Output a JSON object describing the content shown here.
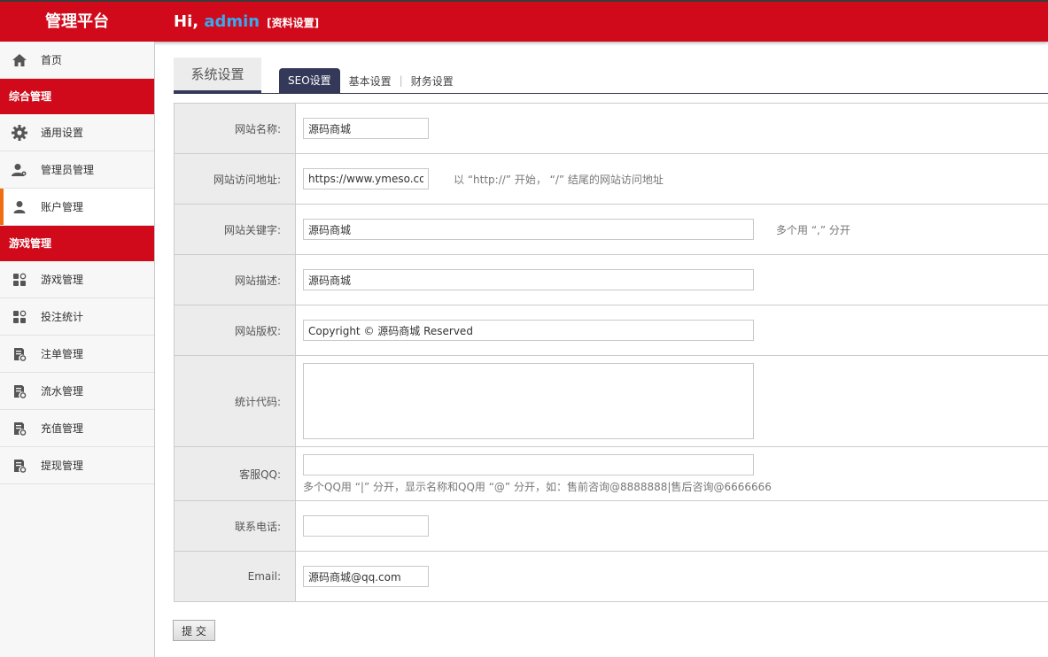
{
  "header": {
    "logo": "管理平台",
    "greeting_prefix": "Hi, ",
    "username": "admin",
    "profile_link": "[资料设置]"
  },
  "sidebar": {
    "home": "首页",
    "group1": "综合管理",
    "items1": [
      "通用设置",
      "管理员管理",
      "账户管理"
    ],
    "group2": "游戏管理",
    "items2": [
      "游戏管理",
      "投注统计",
      "注单管理",
      "流水管理",
      "充值管理",
      "提现管理"
    ]
  },
  "tabs": {
    "main": "系统设置",
    "sub": [
      "SEO设置",
      "基本设置",
      "财务设置"
    ],
    "separator": "|"
  },
  "form": {
    "site_name": {
      "label": "网站名称:",
      "value": "源码商城"
    },
    "site_url": {
      "label": "网站访问地址:",
      "value": "https://www.ymeso.com",
      "hint": "以 “http://” 开始， “/” 结尾的网站访问地址"
    },
    "keywords": {
      "label": "网站关键字:",
      "value": "源码商城",
      "hint": "多个用 “,” 分开"
    },
    "description": {
      "label": "网站描述:",
      "value": "源码商城"
    },
    "copyright": {
      "label": "网站版权:",
      "value": "Copyright © 源码商城 Reserved"
    },
    "stat_code": {
      "label": "统计代码:",
      "value": ""
    },
    "qq": {
      "label": "客服QQ:",
      "value": "",
      "hint": "多个QQ用 “|” 分开，显示名称和QQ用 “@” 分开，如：售前咨询@8888888|售后咨询@6666666"
    },
    "phone": {
      "label": "联系电话:",
      "value": ""
    },
    "email": {
      "label": "Email:",
      "value": "源码商城@qq.com"
    }
  },
  "submit_label": "提 交"
}
